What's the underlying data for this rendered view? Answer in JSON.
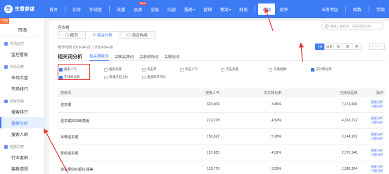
{
  "brand": {
    "logo_glyph": "生",
    "name": "生意参谋"
  },
  "nav": {
    "items": [
      {
        "label": "首页"
      },
      {
        "label": "实时"
      },
      {
        "label": "作战室"
      },
      {
        "label": "流量"
      },
      {
        "label": "品类",
        "new": "NEW"
      },
      {
        "label": "交易"
      },
      {
        "label": "内容"
      },
      {
        "label": "服务",
        "caret": "▾"
      },
      {
        "label": "营销"
      },
      {
        "label": "物流",
        "caret": "▾"
      },
      {
        "label": "财务"
      },
      {
        "label": "市场",
        "active": true
      },
      {
        "label": "竞争"
      }
    ],
    "right": [
      {
        "label": "业务专区"
      },
      {
        "label": "取数"
      },
      {
        "label": "学院"
      }
    ]
  },
  "sidebar": {
    "tag": "市场",
    "head": "市场",
    "groups": [
      {
        "label": "市场监控",
        "items": [
          "监控看板"
        ]
      },
      {
        "label": "供给洞察",
        "items": [
          "市场大盘",
          "市场排行"
        ]
      },
      {
        "label": "搜索洞察",
        "items": [
          "搜索排行",
          "搜索分析",
          "搜索人群"
        ]
      },
      {
        "label": "客群洞察",
        "items": [
          "行业客群",
          "客群透视"
        ]
      }
    ],
    "active_item": "搜索分析"
  },
  "main": {
    "crumb": "连衣裙",
    "search_placeholder": "请输入搜索词，支持对照分析",
    "tabs": [
      {
        "icon": "▢",
        "label": "概况"
      },
      {
        "icon": "⊙",
        "label": "相关分析",
        "active": true
      },
      {
        "icon": "▢",
        "label": "类目构成"
      }
    ],
    "stat_date": "统计时间 2019-04-22 ~ 2019-04-28",
    "ranges": [
      {
        "label": "7天",
        "active": true
      },
      {
        "label": "30天"
      },
      {
        "label": "日"
      },
      {
        "label": "周"
      },
      {
        "label": "月"
      }
    ],
    "pager": [
      "‹",
      "›"
    ],
    "section_title": "相关词分析",
    "subtabs": [
      {
        "label": "相关搜索词",
        "active": true
      },
      {
        "label": "关联品牌词"
      },
      {
        "label": "关联修饰词"
      },
      {
        "label": "关联热词"
      }
    ],
    "metrics": [
      {
        "label": "搜索人气",
        "on": true
      },
      {
        "label": "搜索热度",
        "on": false
      },
      {
        "label": "点击率",
        "on": false
      },
      {
        "label": "点击人气",
        "on": false
      },
      {
        "label": "点击热度",
        "on": false
      },
      {
        "label": "交易指数",
        "on": false
      },
      {
        "label": "支付转化率",
        "on": true
      },
      {
        "label": "在线商品数",
        "on": true
      },
      {
        "label": "商城点击占比",
        "on": false
      },
      {
        "label": "直通车参考价",
        "on": false
      }
    ],
    "table": {
      "headers": [
        "搜索词",
        "搜索人气",
        "支付转化率",
        "在线商品数",
        "操作"
      ],
      "rows": [
        {
          "term": "连衣裙",
          "pop": "323,409",
          "conv": "3.45%",
          "items": "7,174,936"
        },
        {
          "term": "连衣裙2019新款夏",
          "pop": "212,278",
          "conv": "4.52%",
          "items": "4,263,212"
        },
        {
          "term": "吊带连衣裙",
          "pop": "150,621",
          "conv": "5.18%",
          "items": "3,148,932"
        },
        {
          "term": "雪纺连衣裙",
          "pop": "137,635",
          "conv": "4.91%",
          "items": "2,707,346"
        },
        {
          "term": "连衣裙仙女超仙 甜美",
          "pop": "119,770",
          "conv": "3.55%",
          "items": "1,083,204"
        }
      ],
      "op1": "搜索分析",
      "op2": "人群分析"
    }
  }
}
